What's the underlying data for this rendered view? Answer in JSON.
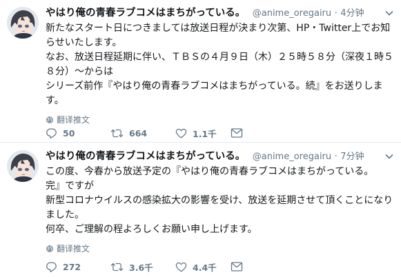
{
  "tweets": [
    {
      "name": "やはり俺の青春ラブコメはまちがっている。",
      "handle": "@anime_oregairu",
      "separator": "·",
      "time": "4分钟",
      "lines": [
        "新たなスタート日につきましては放送日程が決まり次第、HP・Twitter上でお知",
        "らせいたします。",
        "なお、放送日程延期に伴い、ＴＢＳの４月９日（木）２５時５８分（深夜１時５",
        "８分）〜からは",
        "シリーズ前作『やはり俺の青春ラブコメはまちがっている。続』をお送りしま",
        "す。"
      ],
      "translate_label": "翻译推文",
      "replies": "50",
      "retweets": "664",
      "likes": "1.1千"
    },
    {
      "name": "やはり俺の青春ラブコメはまちがっている。",
      "handle": "@anime_oregairu",
      "separator": "·",
      "time": "7分钟",
      "lines": [
        "この度、今春から放送予定の『やはり俺の青春ラブコメはまちがっている。",
        "完』ですが",
        "新型コロナウイルスの感染拡大の影響を受け、放送を延期させて頂くことになり",
        "ました。",
        "何卒、ご理解の程よろしくお願い申し上げます。"
      ],
      "translate_label": "翻译推文",
      "replies": "272",
      "retweets": "3.6千",
      "likes": "4.4千"
    }
  ],
  "icons": {
    "reply": "reply-icon",
    "retweet": "retweet-icon",
    "like": "like-icon",
    "message": "message-icon",
    "globe": "globe-icon",
    "more": "chevron-down-icon"
  },
  "colors": {
    "text": "#14171a",
    "secondary": "#657786",
    "divider": "#e6ecf0"
  }
}
